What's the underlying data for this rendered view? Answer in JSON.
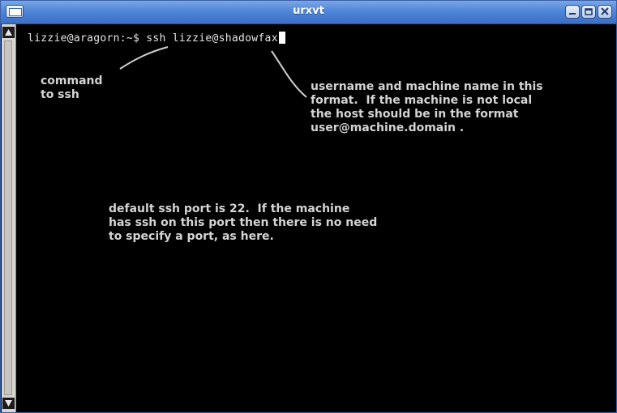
{
  "window": {
    "title": "urxvt",
    "menu_icon": "window-menu-icon",
    "buttons": [
      "minimize-icon",
      "maximize-icon",
      "close-icon"
    ]
  },
  "terminal": {
    "prompt": "lizzie@aragorn:~$ ",
    "command": "ssh lizzie@shadowfax",
    "background": "#000000",
    "foreground": "#e6e6e6"
  },
  "annotations": {
    "command_note": "command\nto ssh",
    "username_note": "username and machine name in this\nformat.  If the machine is not local\nthe host should be in the format\nuser@machine.domain .",
    "port_note": "default ssh port is 22.  If the machine\nhas ssh on this port then there is no need\nto specify a port, as here."
  },
  "colors": {
    "titlebar": "#4f86d8",
    "annotation_text": "#d4d4d4"
  }
}
